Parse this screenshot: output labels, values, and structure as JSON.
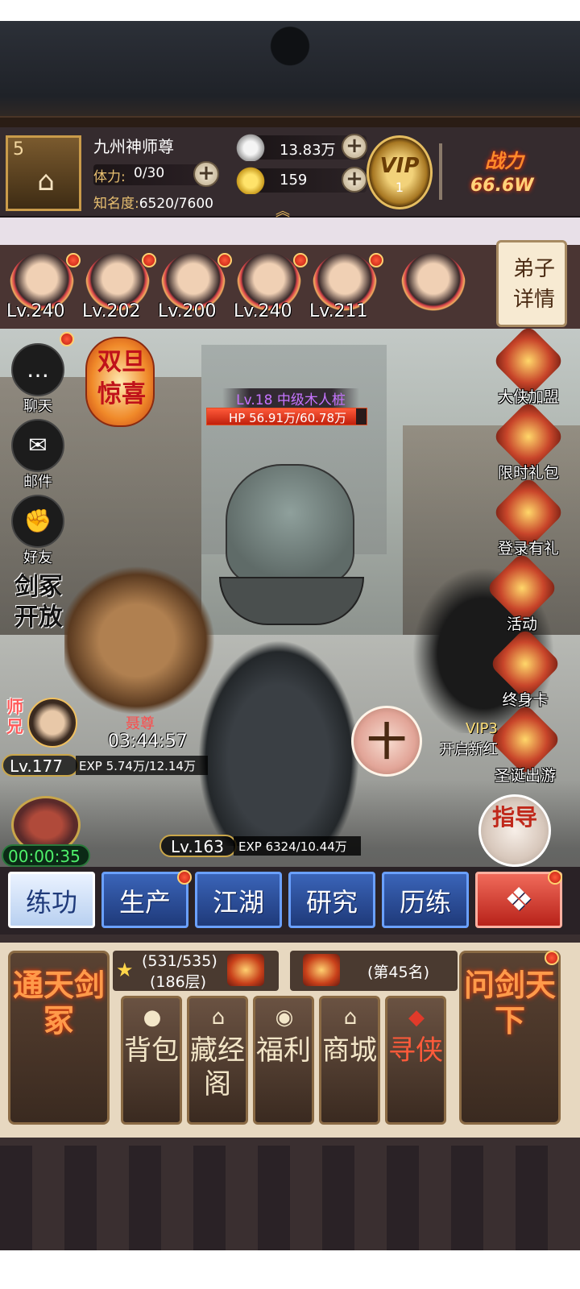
{
  "player": {
    "level": "5",
    "name": "九州神师尊",
    "stamina_label": "体力:",
    "stamina_value": "0/30",
    "fame_label": "知名度:",
    "fame_value": "6520/7600",
    "silver": "13.83万",
    "gold": "159",
    "vip_label": "VIP",
    "vip_level": "1",
    "power_label": "战力",
    "power_value": "66.6W"
  },
  "disciples": {
    "levels": [
      "Lv.240",
      "Lv.202",
      "Lv.200",
      "Lv.240",
      "Lv.211"
    ],
    "detail_label": "弟子详情"
  },
  "left_menu": [
    {
      "label": "聊天",
      "icon": "chat-icon"
    },
    {
      "label": "邮件",
      "icon": "dove-mail-icon"
    },
    {
      "label": "好友",
      "icon": "fist-friends-icon"
    }
  ],
  "event_lantern": "双旦惊喜",
  "jianjia_badge": "剑冢开放",
  "right_menu": [
    {
      "label": "大侠加盟",
      "icon": "hero-mask-icon"
    },
    {
      "label": "限时礼包",
      "icon": "gift-pack-icon"
    },
    {
      "label": "登录有礼",
      "icon": "treasure-chest-icon"
    },
    {
      "label": "活动",
      "icon": "lantern-activity-icon"
    },
    {
      "label": "终身卡",
      "icon": "gold-card-icon"
    },
    {
      "label": "圣诞出游",
      "icon": "christmas-tree-icon"
    }
  ],
  "enemy": {
    "name": "Lv.18 中级木人桩",
    "hp": "HP 56.91万/60.78万",
    "hp_ratio": 0.936
  },
  "shixiong": {
    "tag": "师兄",
    "level": "Lv.177",
    "exp": "EXP 5.74万/12.14万",
    "boss_label": "聂尊",
    "timer": "03:44:57"
  },
  "hall_timer": "00:00:35",
  "hero": {
    "level": "Lv.163",
    "exp": "EXP 6324/10.44万"
  },
  "add_button": "十",
  "vip3_text": "VIP3",
  "vip3_sub": "开启新红",
  "guide_label": "指导",
  "tabs": [
    {
      "label": "练功",
      "active": true
    },
    {
      "label": "生产"
    },
    {
      "label": "江湖"
    },
    {
      "label": "研究"
    },
    {
      "label": "历练"
    },
    {
      "label": "❖"
    }
  ],
  "panel": {
    "left_card": "通天剑冢",
    "right_card": "问剑天下",
    "rank1_a": "(531/535)",
    "rank1_b": "(186层)",
    "rank2": "(第45名)",
    "cards": [
      {
        "label": "背包",
        "icon": "bag-icon"
      },
      {
        "label": "藏经阁",
        "icon": "pavilion-icon"
      },
      {
        "label": "福利",
        "icon": "coin-icon"
      },
      {
        "label": "商城",
        "icon": "shop-icon"
      },
      {
        "label": "寻侠",
        "icon": "scroll-icon"
      }
    ]
  },
  "colors": {
    "accent_gold": "#e9c071",
    "tab_blue": "#3a64b8",
    "power_orange": "#ff8a2a"
  }
}
